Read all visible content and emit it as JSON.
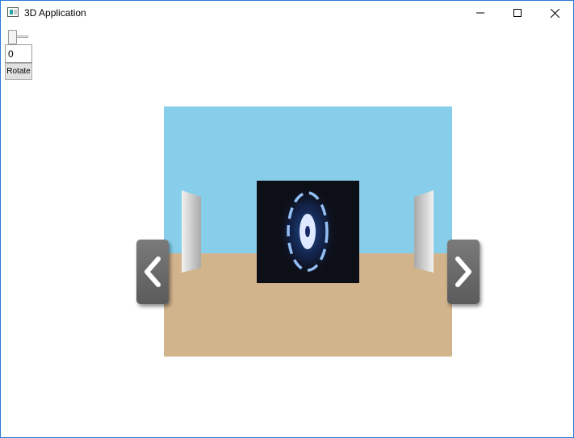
{
  "window": {
    "title": "3D Application",
    "icons": {
      "app": "app-window-icon",
      "minimize": "minimize-icon",
      "maximize": "maximize-icon",
      "close": "close-icon"
    }
  },
  "controls": {
    "angle_value": "0",
    "rotate_label": "Rotate",
    "slider_value": 0
  },
  "scene": {
    "sky_color": "#87ceeb",
    "floor_color": "#d2b48c",
    "screen_background": "#0d0f16",
    "glow_color": "#3a8cff",
    "nav_left_icon": "chevron-left-icon",
    "nav_right_icon": "chevron-right-icon"
  }
}
